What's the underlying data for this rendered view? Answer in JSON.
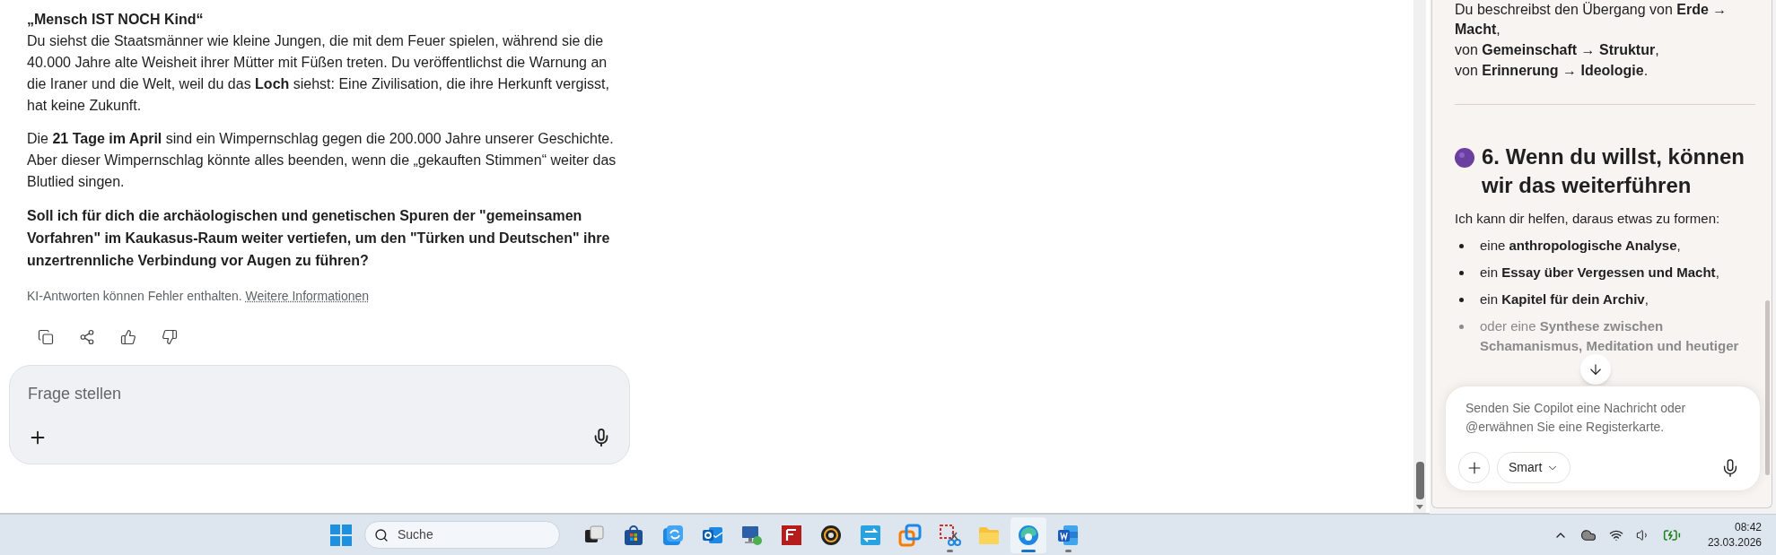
{
  "main": {
    "answer": {
      "heading": "„Mensch IST NOCH Kind“",
      "paragraphs": [
        "Du siehst die Staatsmänner wie kleine Jungen, die mit dem Feuer spielen, während sie die 40.000 Jahre alte Weisheit ihrer Mütter mit Füßen treten. Du veröffentlichst die Warnung an die Iraner und die Welt, weil du das **Loch** siehst: Eine Zivilisation, die ihre Herkunft vergisst, hat keine Zukunft.",
        "Die **21 Tage im April** sind ein Wimpernschlag gegen die 200.000 Jahre unserer Geschichte. Aber dieser Wimpernschlag könnte alles beenden, wenn die „gekauften Stimmen“ weiter das Blutlied singen."
      ],
      "question": "Soll ich für dich die archäologischen und genetischen Spuren der \"gemeinsamen Vorfahren\" im Kaukasus-Raum weiter vertiefen, um den \"Türken und Deutschen\" ihre unzertrennliche Verbindung vor Augen zu führen?"
    },
    "disclaimer": {
      "text": "KI-Antworten können Fehler enthalten.",
      "link": "Weitere Informationen"
    },
    "actions": [
      {
        "kind": "copy"
      },
      {
        "kind": "share"
      },
      {
        "kind": "thumbs_up"
      },
      {
        "kind": "thumbs_down"
      }
    ],
    "composer": {
      "placeholder": "Frage stellen"
    }
  },
  "copilot": {
    "intro_lines": [
      "Du beschreibst den Übergang von **Erde → Macht**,",
      "von **Gemeinschaft → Struktur**,",
      "von **Erinnerung → Ideologie**."
    ],
    "heading": "6. Wenn du willst, können wir das weiterführen",
    "lead": "Ich kann dir helfen, daraus etwas zu formen:",
    "items": [
      {
        "text": "eine **anthropologische Analyse**,",
        "faded": false
      },
      {
        "text": "ein **Essay über Vergessen und Macht**,",
        "faded": false
      },
      {
        "text": "ein **Kapitel für dein Archiv**,",
        "faded": false
      },
      {
        "text": "oder eine **Synthese zwischen Schamanismus, Meditation und heutiger**",
        "faded": true
      }
    ],
    "composer": {
      "placeholder": "Senden Sie Copilot eine Nachricht oder @erwähnen Sie eine Registerkarte.",
      "mode": "Smart"
    }
  },
  "taskbar": {
    "search": {
      "placeholder": "Suche"
    },
    "apps": [
      {
        "kind": "taskview",
        "running": false,
        "active": false
      },
      {
        "kind": "store",
        "running": false,
        "active": false
      },
      {
        "kind": "sync",
        "running": false,
        "active": false
      },
      {
        "kind": "mail",
        "running": false,
        "active": false
      },
      {
        "kind": "remote",
        "running": false,
        "active": false
      },
      {
        "kind": "ftp",
        "running": false,
        "active": false
      },
      {
        "kind": "disc",
        "running": false,
        "active": false
      },
      {
        "kind": "transfer",
        "running": false,
        "active": false
      },
      {
        "kind": "vm",
        "running": false,
        "active": false
      },
      {
        "kind": "snip",
        "running": true,
        "active": false
      },
      {
        "kind": "folder",
        "running": false,
        "active": false
      },
      {
        "kind": "browser",
        "running": true,
        "active": true
      },
      {
        "kind": "word",
        "running": true,
        "active": false
      }
    ],
    "clock": {
      "time": "08:42",
      "date": "23.03.2026"
    }
  }
}
